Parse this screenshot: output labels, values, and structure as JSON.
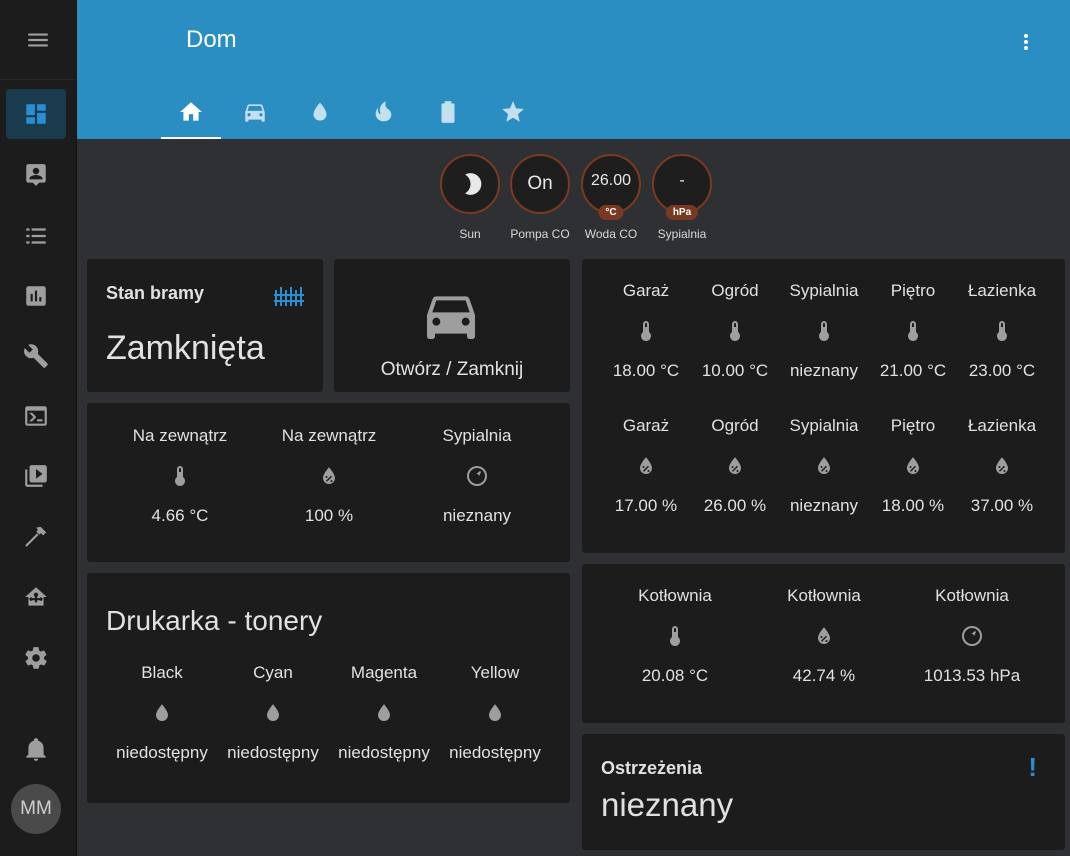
{
  "header": {
    "title": "Dom"
  },
  "sidebar": {
    "items": [
      "menu-icon",
      "overview-icon",
      "map-icon",
      "logbook-icon",
      "history-icon",
      "tools-icon",
      "terminal-icon",
      "media-icon",
      "hammer-icon",
      "home-automation-icon",
      "settings-icon",
      "bell-icon"
    ],
    "avatar": "MM"
  },
  "tabs": [
    "home-icon",
    "car-icon",
    "water-icon",
    "fire-icon",
    "battery-icon",
    "star-icon"
  ],
  "badges": [
    {
      "label": "Sun",
      "value": "",
      "unit": ""
    },
    {
      "label": "Pompa CO",
      "value": "On",
      "unit": ""
    },
    {
      "label": "Woda CO",
      "value": "26.00",
      "unit": "°C"
    },
    {
      "label": "Sypialnia",
      "value": "-",
      "unit": "hPa"
    }
  ],
  "gate": {
    "title": "Stan bramy",
    "state": "Zamknięta"
  },
  "car_button": {
    "label": "Otwórz / Zamknij"
  },
  "outside": [
    {
      "name": "Na zewnątrz",
      "value": "4.66 °C"
    },
    {
      "name": "Na zewnątrz",
      "value": "100 %"
    },
    {
      "name": "Sypialnia",
      "value": "nieznany"
    }
  ],
  "printer": {
    "title": "Drukarka - tonery",
    "items": [
      {
        "name": "Black",
        "value": "niedostępny"
      },
      {
        "name": "Cyan",
        "value": "niedostępny"
      },
      {
        "name": "Magenta",
        "value": "niedostępny"
      },
      {
        "name": "Yellow",
        "value": "niedostępny"
      }
    ]
  },
  "temps": [
    {
      "name": "Garaż",
      "value": "18.00 °C"
    },
    {
      "name": "Ogród",
      "value": "10.00 °C"
    },
    {
      "name": "Sypialnia",
      "value": "nieznany"
    },
    {
      "name": "Piętro",
      "value": "21.00 °C"
    },
    {
      "name": "Łazienka",
      "value": "23.00 °C"
    }
  ],
  "humid": [
    {
      "name": "Garaż",
      "value": "17.00 %"
    },
    {
      "name": "Ogród",
      "value": "26.00 %"
    },
    {
      "name": "Sypialnia",
      "value": "nieznany"
    },
    {
      "name": "Piętro",
      "value": "18.00 %"
    },
    {
      "name": "Łazienka",
      "value": "37.00 %"
    }
  ],
  "boiler": [
    {
      "name": "Kotłownia",
      "value": "20.08 °C"
    },
    {
      "name": "Kotłownia",
      "value": "42.74 %"
    },
    {
      "name": "Kotłownia",
      "value": "1013.53 hPa"
    }
  ],
  "warnings": {
    "title": "Ostrzeżenia",
    "state": "nieznany"
  },
  "colors": {
    "header": "#2b8ec2",
    "accent": "#2a8ed1",
    "badge_border": "#7a3a22"
  }
}
